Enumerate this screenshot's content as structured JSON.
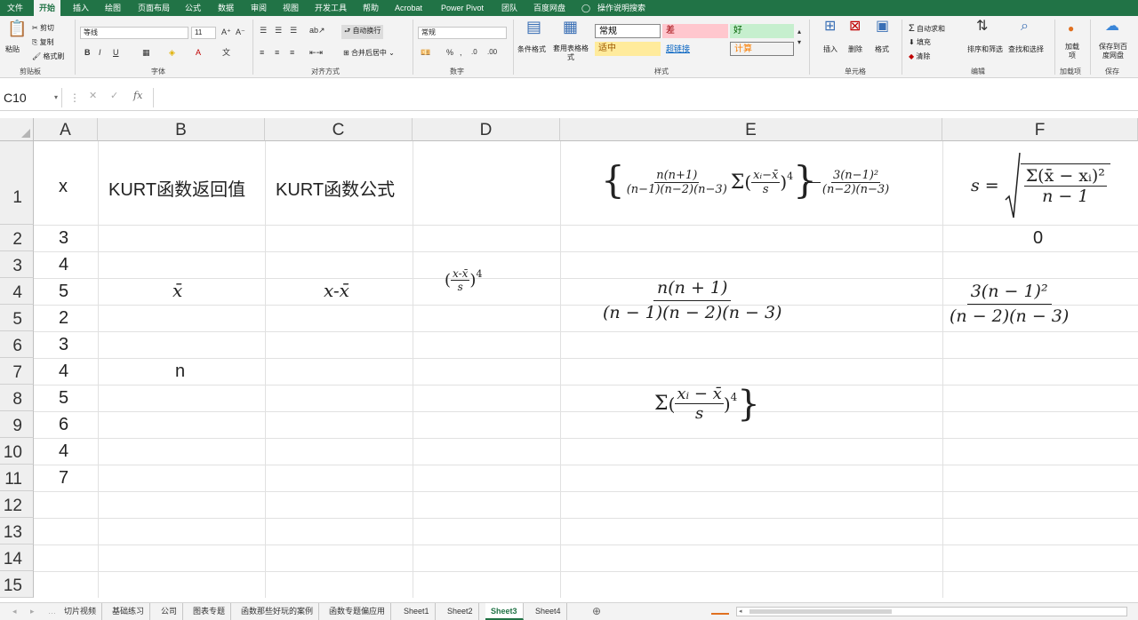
{
  "menu": {
    "file": "文件",
    "tabs": [
      "开始",
      "插入",
      "绘图",
      "页面布局",
      "公式",
      "数据",
      "审阅",
      "视图",
      "开发工具",
      "帮助",
      "Acrobat",
      "Power Pivot",
      "团队",
      "百度网盘"
    ],
    "search": "操作说明搜索"
  },
  "ribbon": {
    "clipboard": {
      "paste": "粘贴",
      "cut": "剪切",
      "copy": "复制",
      "format_painter": "格式刷",
      "label": "剪贴板"
    },
    "font": {
      "name": "等线",
      "size": "11",
      "label": "字体"
    },
    "align": {
      "wrap": "自动换行",
      "merge": "合并后居中",
      "label": "对齐方式"
    },
    "number": {
      "format": "常规",
      "label": "数字"
    },
    "styles": {
      "cond_format": "条件格式",
      "table_format": "套用表格格式",
      "normal": "常规",
      "bad": "差",
      "good": "好",
      "neutral": "适中",
      "hyperlink": "超链接",
      "calc": "计算",
      "label": "样式"
    },
    "cells": {
      "insert": "插入",
      "delete": "删除",
      "format": "格式",
      "label": "单元格"
    },
    "editing": {
      "autosum": "自动求和",
      "fill": "填充",
      "clear": "清除",
      "sort": "排序和筛选",
      "find": "查找和选择",
      "label": "编辑"
    },
    "addins": {
      "load": "加载项",
      "label": "加载项"
    },
    "save": {
      "save_to": "保存到百度网盘",
      "label": "保存"
    }
  },
  "formula_bar": {
    "name_box": "C10",
    "formula": ""
  },
  "columns": [
    "A",
    "B",
    "C",
    "D",
    "E",
    "F"
  ],
  "rows": [
    "1",
    "2",
    "3",
    "4",
    "5",
    "6",
    "7",
    "8",
    "9",
    "10",
    "11",
    "12",
    "13",
    "14",
    "15"
  ],
  "cells": {
    "A1": "x",
    "B1": "KURT函数返回值",
    "C1": "KURT函数公式",
    "A2": "3",
    "A3": "4",
    "A4": "5",
    "A5": "2",
    "A6": "3",
    "A7": "4",
    "A8": "5",
    "A9": "6",
    "A10": "4",
    "A11": "7",
    "B4": "x̄",
    "C4": "x-x̄",
    "B7": "n",
    "F2": "0"
  },
  "math": {
    "e1_frac_num": "n(n+1)",
    "e1_frac_den": "(n−1)(n−2)(n−3)",
    "e1_sigma": "Σ",
    "e1_inner_num": "xᵢ−x̄",
    "e1_inner_den": "s",
    "e1_power": "4",
    "e1_right_num": "3(n−1)²",
    "e1_right_den": "(n−2)(n−3)",
    "f1_lhs": "s =",
    "f1_num": "Σ(x̄ − xᵢ)²",
    "f1_den": "n − 1",
    "d4_num": "x-x̄",
    "d4_den": "s",
    "d4_power": "4",
    "e4_num": "n(n + 1)",
    "e4_den": "(n − 1)(n − 2)(n − 3)",
    "f4_num": "3(n − 1)²",
    "f4_den": "(n − 2)(n − 3)",
    "e8_sigma": "Σ",
    "e8_num": "xᵢ − x̄",
    "e8_den": "s",
    "e8_power": "4"
  },
  "sheet_tabs": [
    "切片视频",
    "基础练习",
    "公司",
    "图表专题",
    "函数那些好玩的案例",
    "函数专题偏应用",
    "Sheet1",
    "Sheet2",
    "Sheet3",
    "Sheet4"
  ],
  "active_sheet": "Sheet3",
  "accent": "#217346"
}
